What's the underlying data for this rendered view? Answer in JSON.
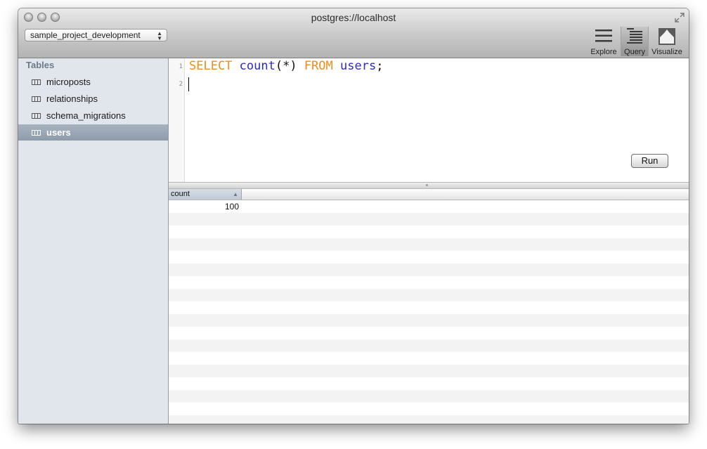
{
  "window": {
    "title": "postgres://localhost"
  },
  "toolbar": {
    "database": "sample_project_development",
    "explore_label": "Explore",
    "query_label": "Query",
    "visualize_label": "Visualize"
  },
  "sidebar": {
    "header": "Tables",
    "items": [
      {
        "label": "microposts"
      },
      {
        "label": "relationships"
      },
      {
        "label": "schema_migrations"
      },
      {
        "label": "users"
      }
    ]
  },
  "editor": {
    "line_numbers": [
      "1",
      "2"
    ],
    "tokens": {
      "select": "SELECT",
      "count": "count",
      "star": "(*)",
      "from": "FROM",
      "table": "users",
      "semicolon": ";"
    },
    "run_label": "Run"
  },
  "results": {
    "columns": [
      "count"
    ],
    "rows": [
      [
        "100"
      ]
    ]
  },
  "colors": {
    "keyword": "#f08c1c",
    "identifier": "#2a2ad2",
    "selection": "#98a5b5"
  }
}
